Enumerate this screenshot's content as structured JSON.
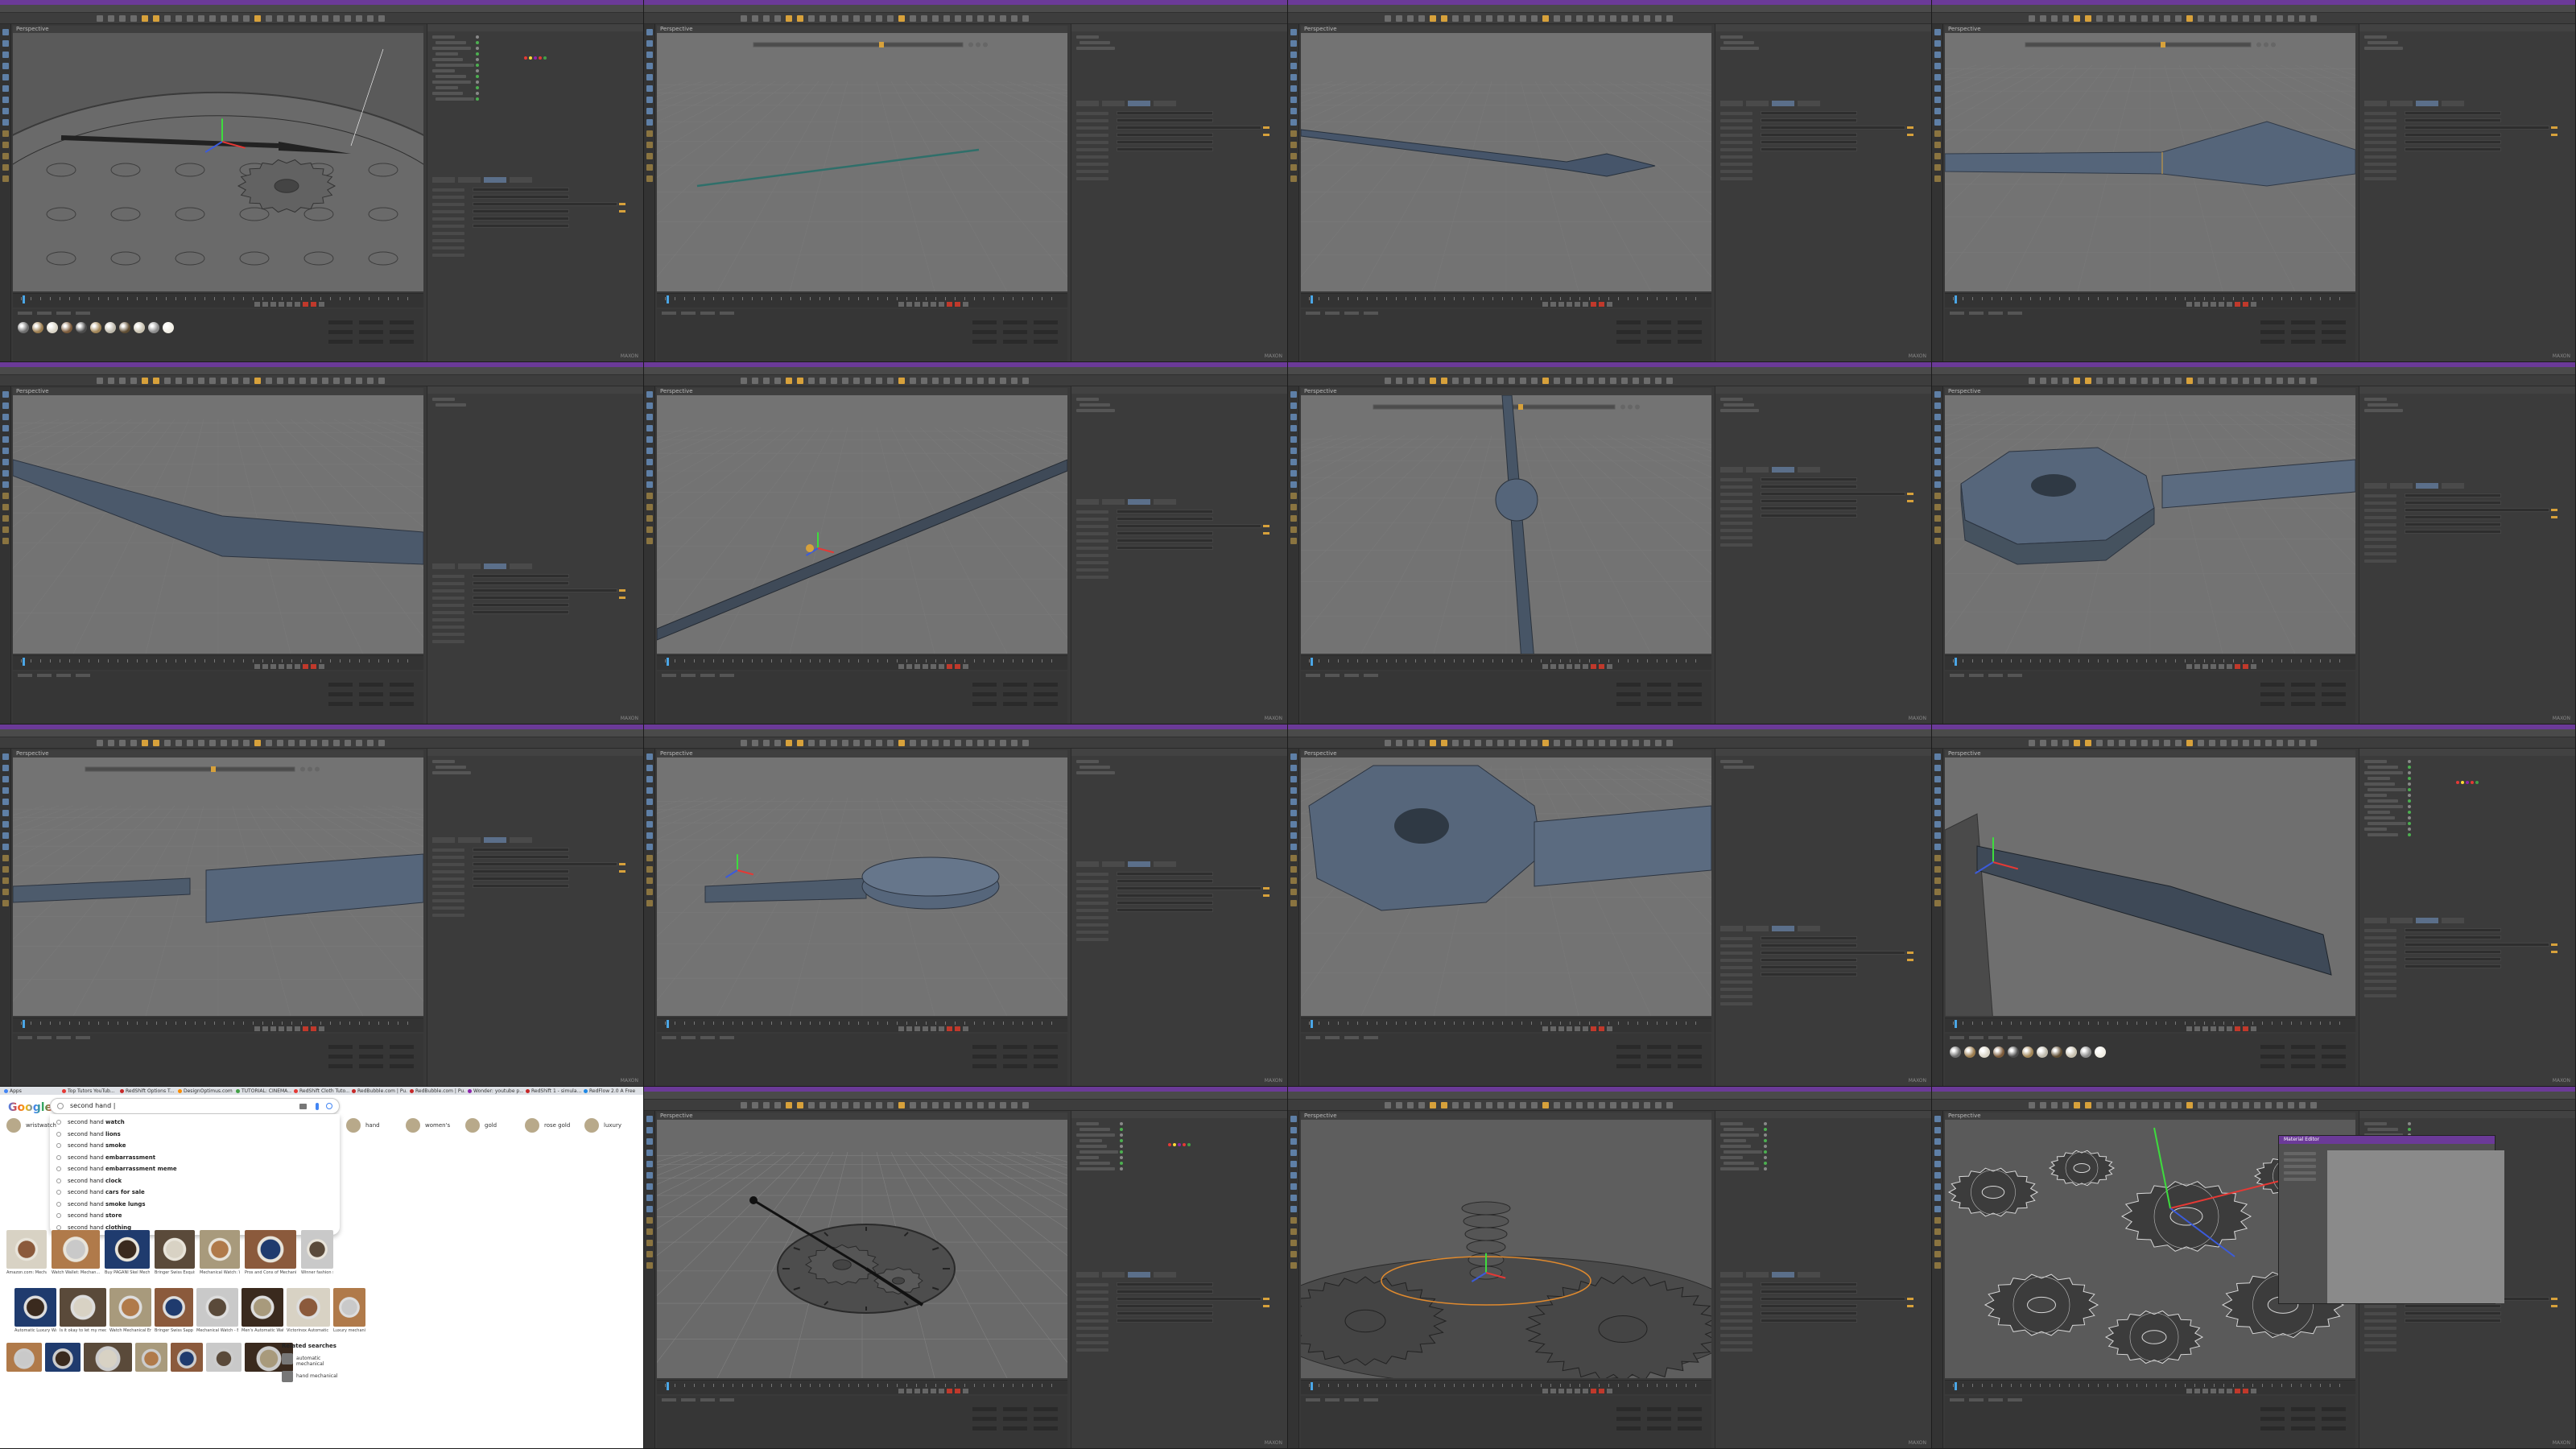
{
  "window": {
    "app_name": "Cinema 4D",
    "brand_label": "MAXON"
  },
  "tiles": [
    {
      "id": "t1",
      "viewport_label": "Perspective",
      "scene": "watch-gears-wide"
    },
    {
      "id": "t2",
      "viewport_label": "Perspective",
      "scene": "thin-needle"
    },
    {
      "id": "t3",
      "viewport_label": "Perspective",
      "scene": "spear-needle"
    },
    {
      "id": "t4",
      "viewport_label": "Perspective",
      "scene": "hand-closeup"
    },
    {
      "id": "t5",
      "viewport_label": "Perspective",
      "scene": "hand-blade"
    },
    {
      "id": "t6",
      "viewport_label": "Perspective",
      "scene": "diagonal-rod"
    },
    {
      "id": "t7",
      "viewport_label": "Perspective",
      "scene": "vertical-hand-hub"
    },
    {
      "id": "t8",
      "viewport_label": "Perspective",
      "scene": "octagon-hub"
    },
    {
      "id": "t9",
      "viewport_label": "Perspective",
      "scene": "bridge-blocks"
    },
    {
      "id": "t10",
      "viewport_label": "Perspective",
      "scene": "flat-hub"
    },
    {
      "id": "t11",
      "viewport_label": "Perspective",
      "scene": "octagon-closeup"
    },
    {
      "id": "t12",
      "viewport_label": "Perspective",
      "scene": "blade-in-scene"
    },
    {
      "id": "t13",
      "viewport_label": "",
      "scene": "browser"
    },
    {
      "id": "t14",
      "viewport_label": "Perspective",
      "scene": "watch-top"
    },
    {
      "id": "t15",
      "viewport_label": "Perspective",
      "scene": "gears-side"
    },
    {
      "id": "t16",
      "viewport_label": "Perspective",
      "scene": "gears-wire"
    }
  ],
  "browser": {
    "tabs": [
      "Apps",
      "Top Tutors YouTub...",
      "RedShift Options T...",
      "DesignOptimus.com",
      "TUTORIAL: CINEMA...",
      "RedShift Cloth Tuto...",
      "RedBubble.com | Pu...",
      "RedBubble.com | Pu...",
      "Wonder: youtube p...",
      "RedShift 1 - simula...",
      "RedFlow 2.0 A Free"
    ],
    "logo": "Google",
    "search_query": "second hand |",
    "suggestions": [
      {
        "prefix": "second hand ",
        "bold": "watch"
      },
      {
        "prefix": "second hand ",
        "bold": "lions"
      },
      {
        "prefix": "second hand ",
        "bold": "smoke"
      },
      {
        "prefix": "second hand ",
        "bold": "embarrassment"
      },
      {
        "prefix": "second hand ",
        "bold": "embarrassment meme"
      },
      {
        "prefix": "second hand ",
        "bold": "clock"
      },
      {
        "prefix": "second hand ",
        "bold": "cars for sale"
      },
      {
        "prefix": "second hand ",
        "bold": "smoke lungs"
      },
      {
        "prefix": "second hand ",
        "bold": "store"
      },
      {
        "prefix": "second hand ",
        "bold": "clothing"
      }
    ],
    "chips": [
      "hand",
      "women's",
      "gold",
      "rose gold",
      "luxury"
    ],
    "chip_left": "wristwatch",
    "results_row1": [
      "Amazon.com: Mechanical Watch...",
      "Watch Wallet: Mechan...",
      "Buy PAGANI Skel Mechanical...",
      "Bringer Swiss Exquisite Mecha...",
      "Mechanical Watch: What the T...",
      "Pros and Cons of Mechanical Watches",
      "Winner fashion skeleton..."
    ],
    "results_row2": [
      "Automatic Luxury Watch",
      "Is it okay to let my mechanical...",
      "Watch Mechanical Engraving...",
      "Bringer Swiss Sapphire Crystal...",
      "Mechanical Watch - Bringer Swiss...",
      "Men's Automatic Watch Brands...",
      "Victorinox Automatic Watch Mecha...",
      "Luxury mechanical..."
    ],
    "related_title": "Related searches",
    "related": [
      "automatic mechanical",
      "hand mechanical"
    ]
  },
  "dialog": {
    "title": "Material Editor"
  }
}
